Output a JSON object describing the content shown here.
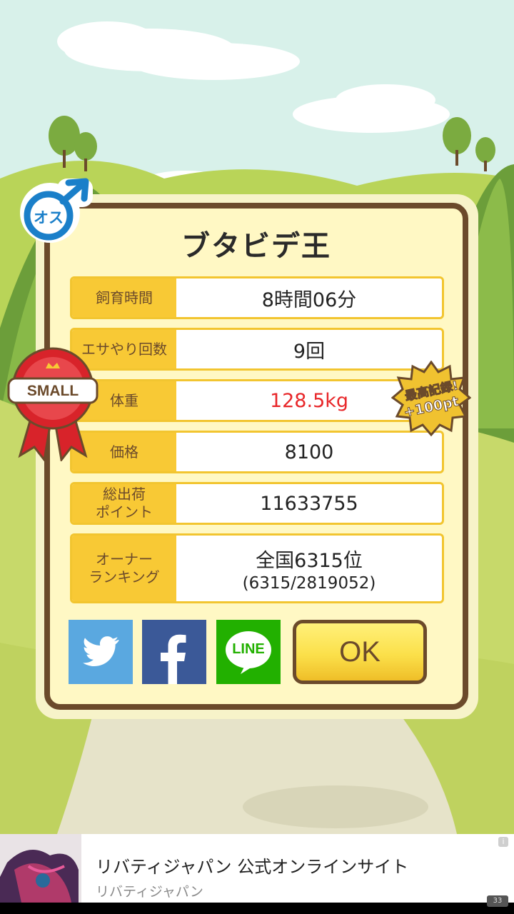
{
  "pig": {
    "name": "ブタビデ王",
    "gender_label": "オス",
    "size_label": "SMALL",
    "record_label": "最高記録!",
    "record_points": "+100pt"
  },
  "stats": [
    {
      "label": "飼育時間",
      "value": "8時間06分",
      "highlight": false
    },
    {
      "label": "エサやり回数",
      "value": "9回",
      "highlight": false
    },
    {
      "label": "体重",
      "value": "128.5kg",
      "highlight": true
    },
    {
      "label": "価格",
      "value": "8100",
      "highlight": false
    },
    {
      "label": "総出荷\nポイント",
      "value": "11633755",
      "highlight": false
    },
    {
      "label": "オーナー\nランキング",
      "value": "全国6315位",
      "sub": "(6315/2819052)",
      "highlight": false
    }
  ],
  "share": {
    "twitter_icon": "twitter-icon",
    "facebook_icon": "facebook-icon",
    "line_label": "LINE"
  },
  "ok_label": "OK",
  "ad": {
    "title": "リバティジャパン 公式オンラインサイト",
    "advertiser": "リバティジャパン",
    "info": "i",
    "corner": "33"
  },
  "colors": {
    "frame": "#6b4a2b",
    "label_bg": "#f8c935",
    "panel_bg": "#fff8c4",
    "highlight": "#e8272a",
    "twitter": "#5aa8e0",
    "facebook": "#3b5998",
    "line": "#22b000",
    "male": "#1a7fc9"
  }
}
